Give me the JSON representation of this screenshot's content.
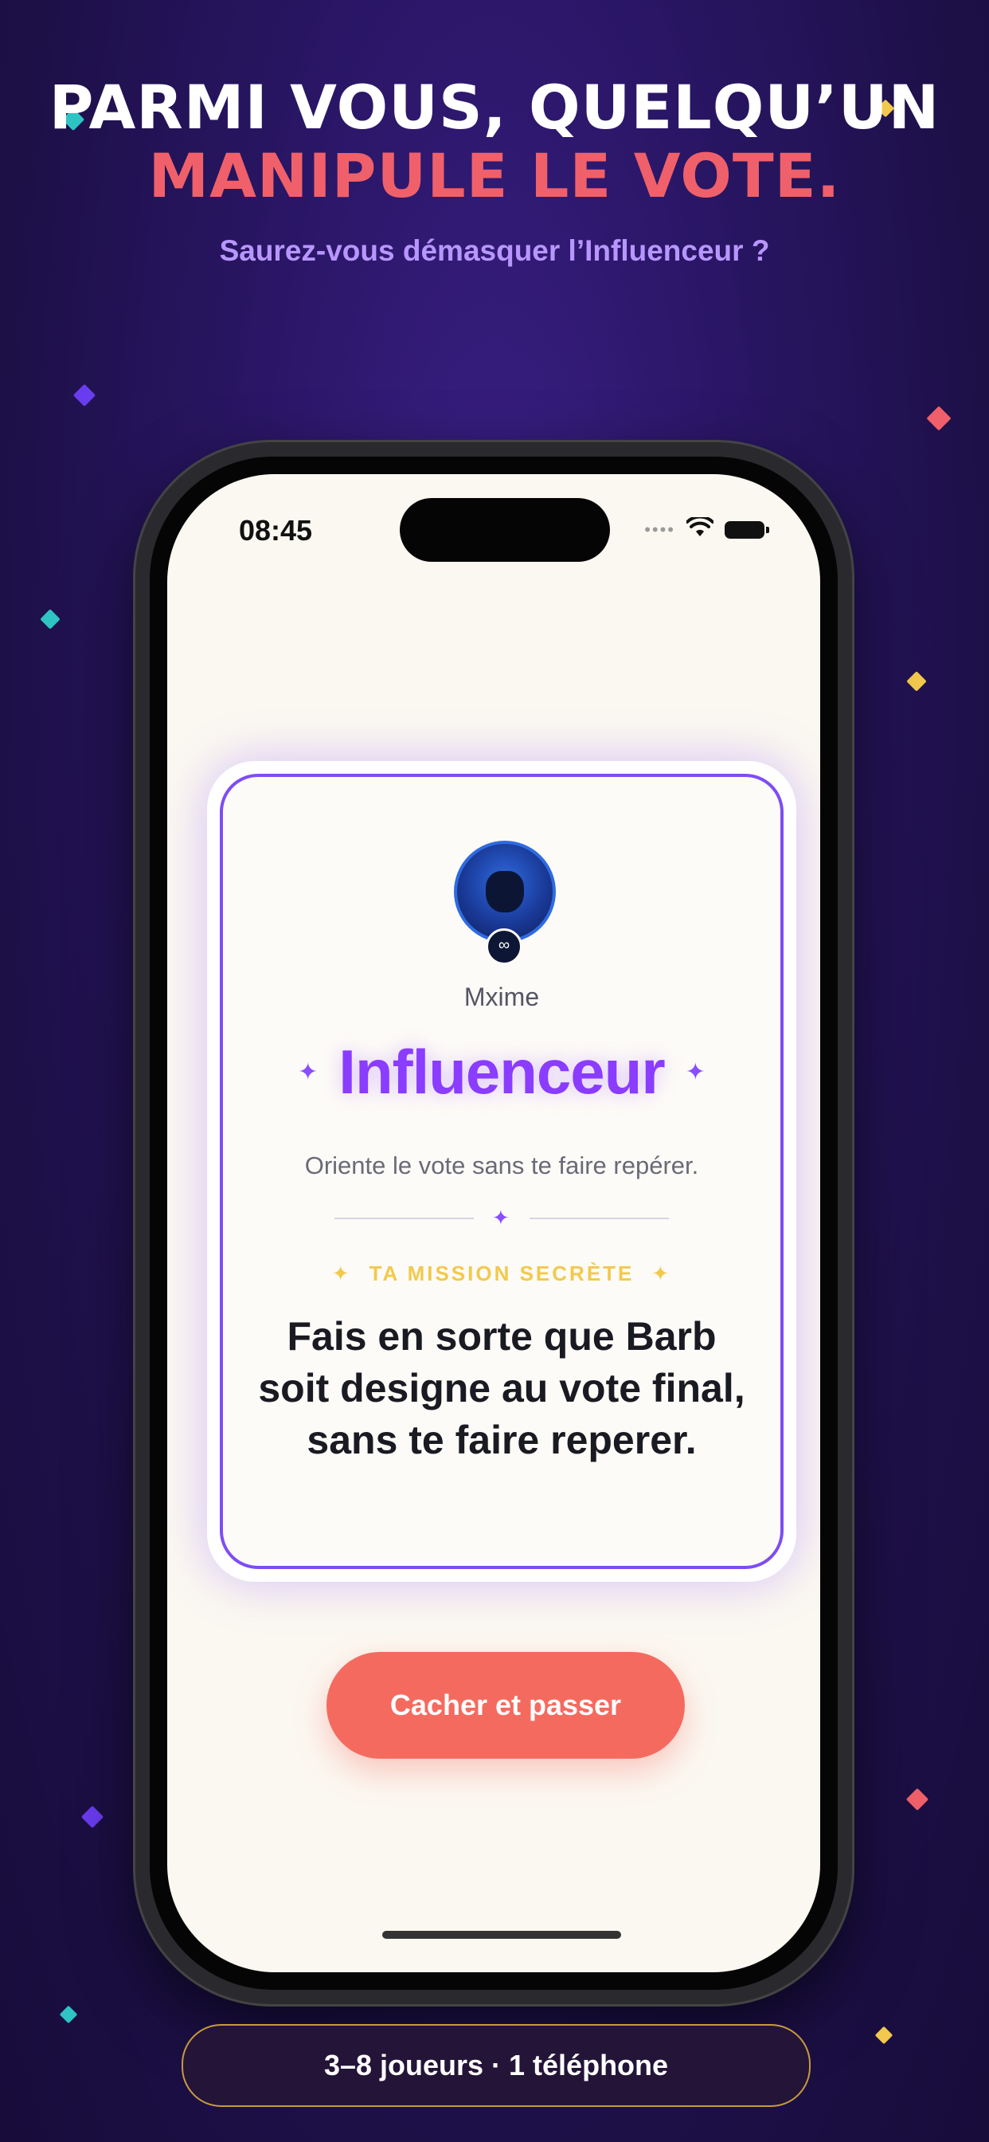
{
  "headline": {
    "line1": "PARMI VOUS, QUELQU’UN",
    "line2": "MANIPULE LE VOTE.",
    "subtitle": "Saurez-vous démasquer l’Influenceur ?"
  },
  "phone": {
    "status_bar": {
      "time": "08:45",
      "icons": [
        "signal-dots-icon",
        "wifi-icon",
        "battery-icon"
      ]
    },
    "card": {
      "player_name": "Mxime",
      "role_name": "Influenceur",
      "role_description": "Oriente le vote sans te faire repérer.",
      "mission_label": "TA MISSION SECRÈTE",
      "mission_text": "Fais en sorte que Barb soit designe au vote final, sans te faire reperer.",
      "sparkle": "✦"
    },
    "cta_label": "Cacher et passer"
  },
  "footer": {
    "label": "3–8 joueurs · 1 téléphone"
  },
  "colors": {
    "background": "#2a1666",
    "accent_coral": "#f0606a",
    "accent_purple": "#8a3cff",
    "accent_gold": "#f2c94c",
    "subtitle_lavender": "#b896ff",
    "button": "#f56a5f"
  }
}
